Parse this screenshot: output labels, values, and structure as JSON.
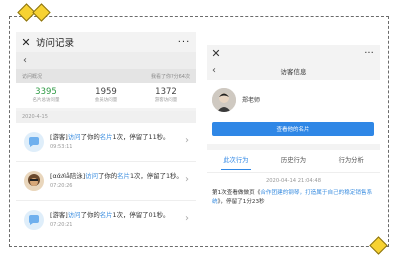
{
  "left": {
    "close_icon": "close-icon",
    "title": "访问记录",
    "more": "···",
    "back": "‹",
    "overview_label": "访问概况",
    "overview_right": "我看了你?分64次",
    "stats": [
      {
        "value": "3395",
        "label": "名片总访问量"
      },
      {
        "value": "1959",
        "label": "会员访问量"
      },
      {
        "value": "1372",
        "label": "游客访问量"
      }
    ],
    "date": "2020-4-15",
    "visits": [
      {
        "name": "[游客]",
        "link": "访问",
        "mid": "了你的",
        "card": "名片",
        "rest": "1次，停留了11秒。",
        "time": "09:53:11"
      },
      {
        "name": "[αά∂ìå陪泳]",
        "link": "访问",
        "mid": "了你的",
        "card": "名片",
        "rest": "1次，停留了1秒。",
        "time": "07:20:26"
      },
      {
        "name": "[游客]",
        "link": "访问",
        "mid": "了你的",
        "card": "名片",
        "rest": "1次，停留了01秒。",
        "time": "07:20:21"
      }
    ]
  },
  "right": {
    "close": "✕",
    "more": "···",
    "back": "‹",
    "title": "访客信息",
    "name": "郑老师",
    "button": "查看他的名片",
    "tabs": [
      "此次行为",
      "历史行为",
      "行为分析"
    ],
    "timestamp": "2020-04-14 21:04:48",
    "desc_pre": "第1次查看做做页《",
    "desc_link": "合作团建的钢琴，打造属于自己的稳定销售系统",
    "desc_post": "》，停留了1分23秒"
  },
  "colors": {
    "accent": "#2f87e6",
    "green": "#2e9a44",
    "diamond": "#f7d232"
  }
}
